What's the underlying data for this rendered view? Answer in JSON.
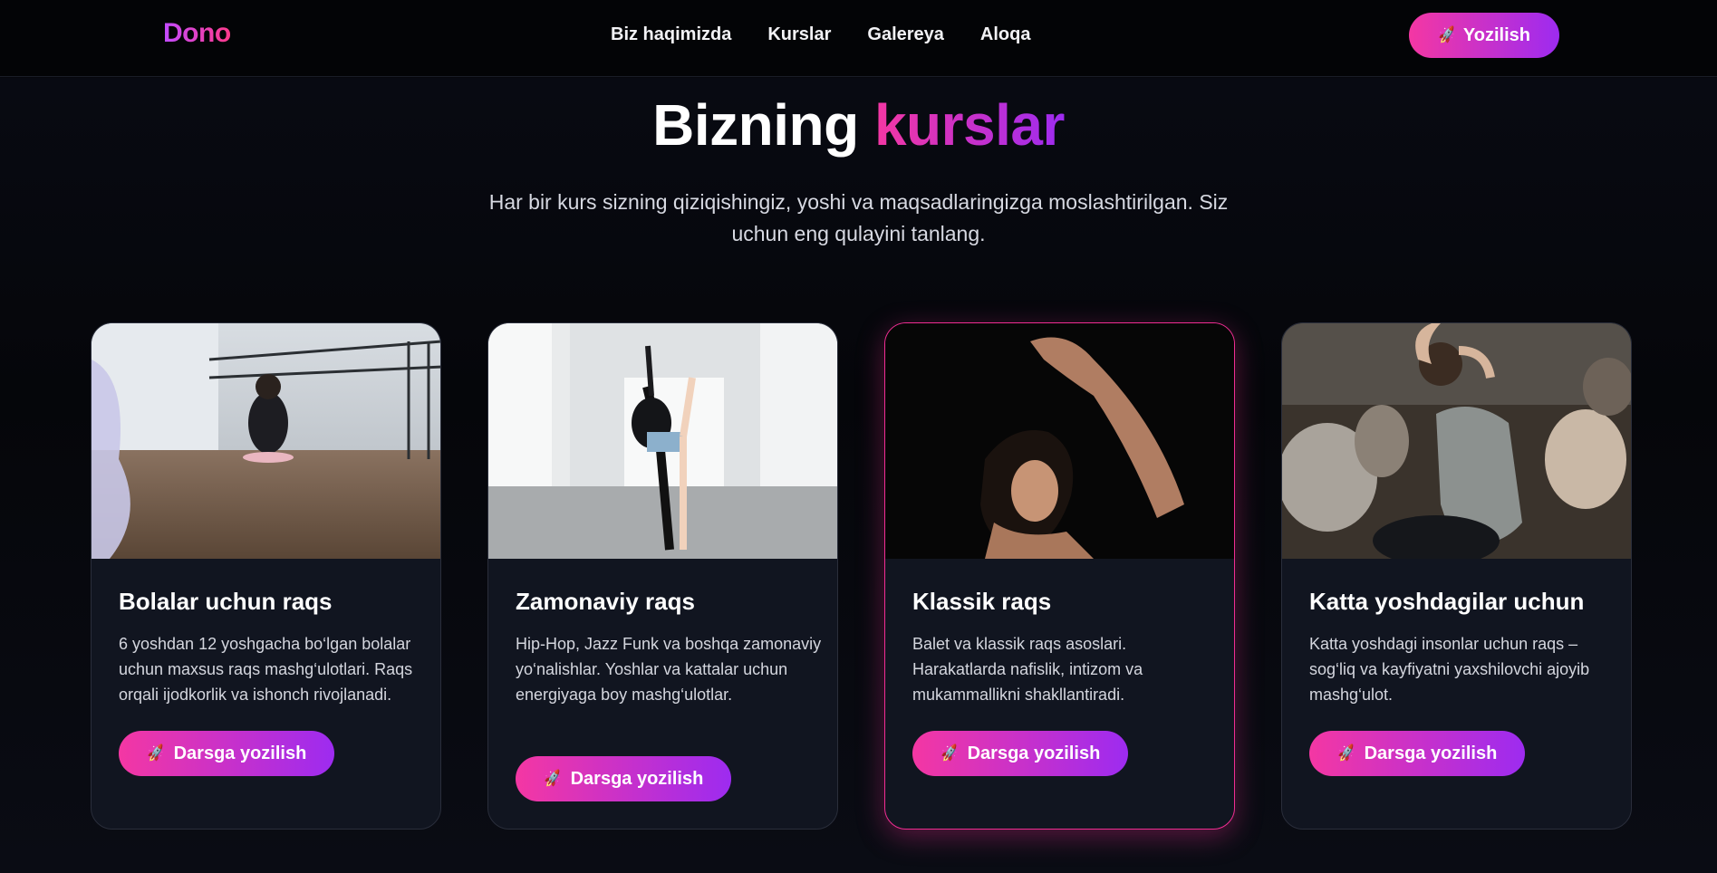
{
  "nav": {
    "logo": "Dono",
    "links": [
      "Biz haqimizda",
      "Kurslar",
      "Galereya",
      "Aloqa"
    ],
    "cta_label": "Yozilish",
    "cta_icon": "rocket-icon"
  },
  "section": {
    "title_plain": "Bizning",
    "title_accent": "kurslar",
    "subtitle": "Har bir kurs sizning qiziqishingiz, yoshi va maqsadlaringizga moslashtirilgan. Siz uchun eng qulayini tanlang."
  },
  "courses": [
    {
      "title": "Bolalar uchun raqs",
      "description": "6 yoshdan 12 yoshgacha bo‘lgan bolalar uchun maxsus raqs mashg‘ulotlari. Raqs orqali ijodkorlik va ishonch rivojlanadi.",
      "button": "Darsga yozilish"
    },
    {
      "title": "Zamonaviy raqs",
      "description": "Hip-Hop, Jazz Funk va boshqa zamonaviy yo‘nalishlar. Yoshlar va kattalar uchun energiyaga boy mashg‘ulotlar.",
      "button": "Darsga yozilish"
    },
    {
      "title": "Klassik raqs",
      "description": "Balet va klassik raqs asoslari. Harakatlarda nafislik, intizom va mukammallikni shakllantiradi.",
      "button": "Darsga yozilish"
    },
    {
      "title": "Katta yoshdagilar uchun",
      "description": "Katta yoshdagi insonlar uchun raqs – sog‘liq va kayfiyatni yaxshilovchi ajoyib mashg‘ulot.",
      "button": "Darsga yozilish"
    }
  ],
  "colors": {
    "accent_pink": "#f437a3",
    "accent_purple": "#9d2bf0",
    "card_bg": "#111520",
    "active_border": "#f02d92"
  }
}
